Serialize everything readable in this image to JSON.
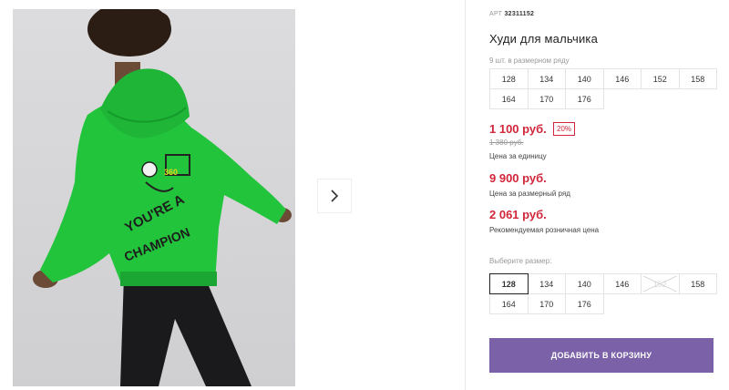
{
  "product": {
    "article_label": "АРТ",
    "article_number": "32311152",
    "title": "Худи для мальчика",
    "series_note": "9 шт. в размерном ряду",
    "series_sizes": [
      "128",
      "134",
      "140",
      "146",
      "152",
      "158",
      "164",
      "170",
      "176"
    ]
  },
  "pricing": {
    "unit_price": "1 100 руб.",
    "discount_badge": "20%",
    "old_price": "1 380 руб.",
    "unit_price_label": "Цена за единицу",
    "series_price": "9 900 руб.",
    "series_price_label": "Цена за размерный ряд",
    "retail_price": "2 061 руб.",
    "retail_price_label": "Рекомендуемая розничная цена",
    "price_color": "#d1263b"
  },
  "size_picker": {
    "label": "Выберите размер:",
    "sizes": [
      {
        "label": "128",
        "state": "selected"
      },
      {
        "label": "134",
        "state": "available"
      },
      {
        "label": "140",
        "state": "available"
      },
      {
        "label": "146",
        "state": "available"
      },
      {
        "label": "152",
        "state": "unavailable"
      },
      {
        "label": "158",
        "state": "available"
      },
      {
        "label": "164",
        "state": "available"
      },
      {
        "label": "170",
        "state": "available"
      },
      {
        "label": "176",
        "state": "available"
      }
    ]
  },
  "cart_button": {
    "label": "ДОБАВИТЬ В КОРЗИНУ",
    "color": "#7b62a8"
  },
  "gallery": {
    "next_icon": "chevron-right-icon",
    "hoodie_color": "#22c43c"
  }
}
